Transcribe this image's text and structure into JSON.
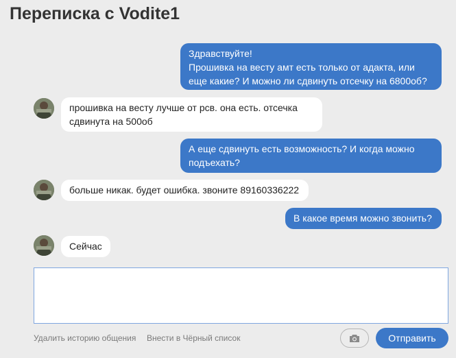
{
  "header": {
    "title": "Переписка с Vodite1"
  },
  "messages": [
    {
      "direction": "outgoing",
      "text": "Здравствуйте!\nПрошивка на весту амт есть только от адакта, или\nеще какие? И можно ли сдвинуть отсечку на 6800об?"
    },
    {
      "direction": "incoming",
      "text": "прошивка на весту лучше от рсв. она есть. отсечка\nсдвинута на 500об"
    },
    {
      "direction": "outgoing",
      "text": "А еще сдвинуть есть возможность? И когда можно\nподъехать?"
    },
    {
      "direction": "incoming",
      "text": "больше никак. будет ошибка. звоните 89160336222"
    },
    {
      "direction": "outgoing",
      "text": "В какое время можно звонить?"
    },
    {
      "direction": "incoming",
      "text": "Сейчас"
    }
  ],
  "composer": {
    "value": "",
    "placeholder": ""
  },
  "footer": {
    "clear_history": "Удалить историю общения",
    "blacklist": "Внести в Чёрный список",
    "attach_icon": "camera-icon",
    "send_label": "Отправить"
  },
  "colors": {
    "background": "#ececec",
    "outgoing_bubble": "#3c78c8",
    "incoming_bubble": "#ffffff",
    "accent": "#3c78c8"
  }
}
